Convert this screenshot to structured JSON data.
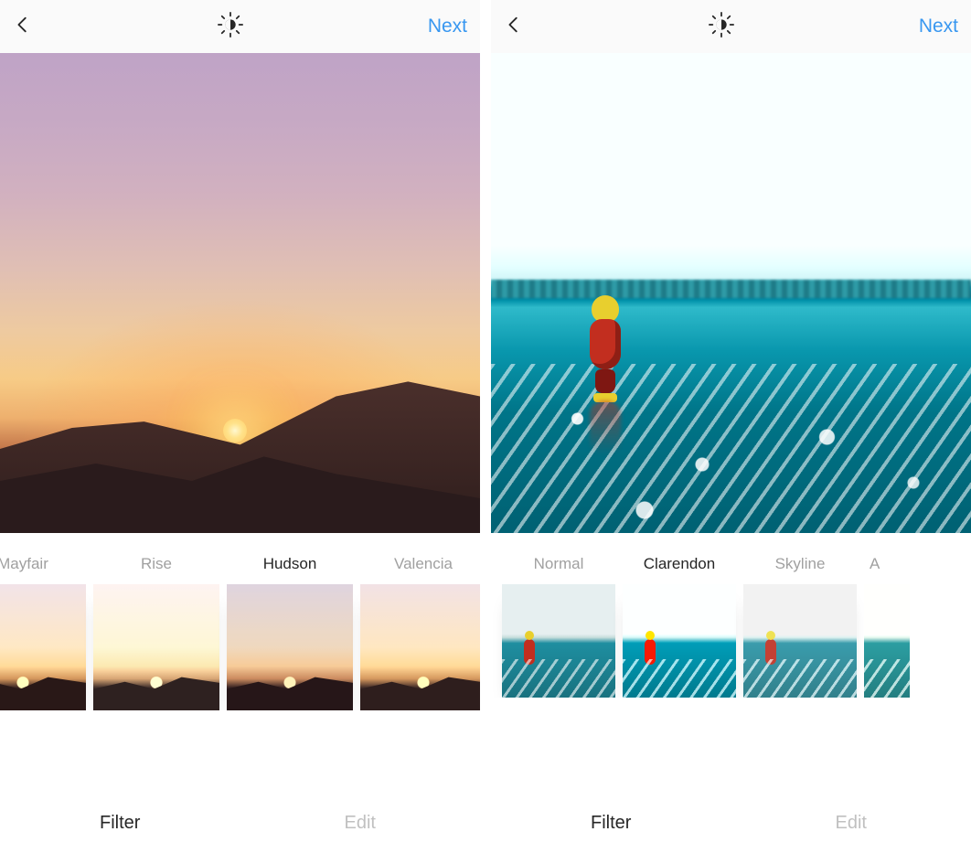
{
  "colors": {
    "accent": "#3897f0",
    "text": "#262626",
    "muted": "#a0a0a0"
  },
  "screens": [
    {
      "header": {
        "back_icon": "chevron-left",
        "center_icon": "lux",
        "next_label": "Next"
      },
      "preview_scene": "sunset",
      "filters": [
        {
          "name": "Mayfair",
          "variant": "v-mayfair",
          "selected": false
        },
        {
          "name": "Rise",
          "variant": "v-rise",
          "selected": false
        },
        {
          "name": "Hudson",
          "variant": "v-hudson",
          "selected": true
        },
        {
          "name": "Valencia",
          "variant": "v-valencia",
          "selected": false
        }
      ],
      "tabs": {
        "filter_label": "Filter",
        "edit_label": "Edit",
        "active": "filter"
      }
    },
    {
      "header": {
        "back_icon": "chevron-left",
        "center_icon": "lux",
        "next_label": "Next"
      },
      "preview_scene": "beach",
      "filters": [
        {
          "name": "Normal",
          "variant": "v-normal",
          "selected": false
        },
        {
          "name": "Clarendon",
          "variant": "v-clarendon",
          "selected": true
        },
        {
          "name": "Skyline",
          "variant": "v-skyline",
          "selected": false
        },
        {
          "name": "Amaro",
          "variant": "v-amaro",
          "selected": false,
          "cut": true
        }
      ],
      "tabs": {
        "filter_label": "Filter",
        "edit_label": "Edit",
        "active": "filter"
      }
    }
  ]
}
